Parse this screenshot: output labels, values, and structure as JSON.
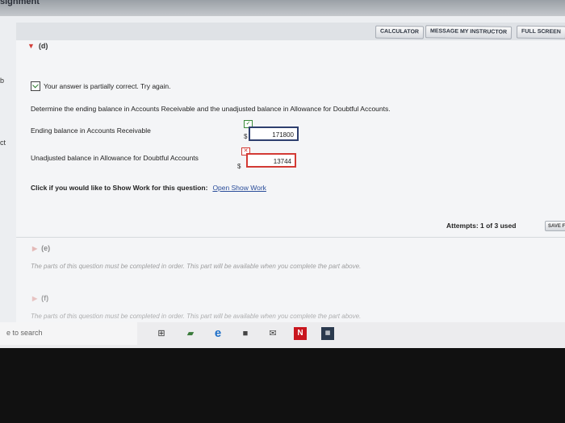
{
  "window": {
    "top_text": "signment"
  },
  "toolbar": {
    "calculator": "CALCULATOR",
    "message_instructor": "MESSAGE MY INSTRUCTOR",
    "full_screen": "FULL SCREEN"
  },
  "left_edge": {
    "b_text": "b",
    "ct_text": "ct"
  },
  "part_d": {
    "label": "(d)",
    "status": "Your answer is partially correct.  Try again.",
    "question": "Determine the ending balance in Accounts Receivable and the unadjusted balance in Allowance for Doubtful Accounts.",
    "fields": [
      {
        "label": "Ending balance in Accounts Receivable",
        "currency": "$",
        "value": "171800",
        "status": "correct"
      },
      {
        "label": "Unadjusted balance in Allowance for Doubtful Accounts",
        "currency": "$",
        "value": "13744",
        "status": "incorrect"
      }
    ],
    "show_work_prompt": "Click if you would like to Show Work for this question:",
    "show_work_link": "Open Show Work",
    "attempts": "Attempts: 1 of 3 used",
    "save_label": "SAVE F"
  },
  "part_e": {
    "label": "(e)",
    "notice": "The parts of this question must be completed in order. This part will be available when you complete the part above."
  },
  "part_f": {
    "label": "(f)",
    "notice": "The parts of this question must be completed in order. This part will be available when you complete the part above."
  },
  "taskbar": {
    "search_placeholder": "e to search",
    "icons": [
      "task-view-icon",
      "store-icon",
      "edge-icon",
      "files-icon",
      "mail-icon",
      "netflix-icon",
      "app-icon"
    ]
  },
  "colors": {
    "accent_red": "#d33a34",
    "link_blue": "#2a4d9a",
    "correct_border": "#2e3f6e"
  }
}
